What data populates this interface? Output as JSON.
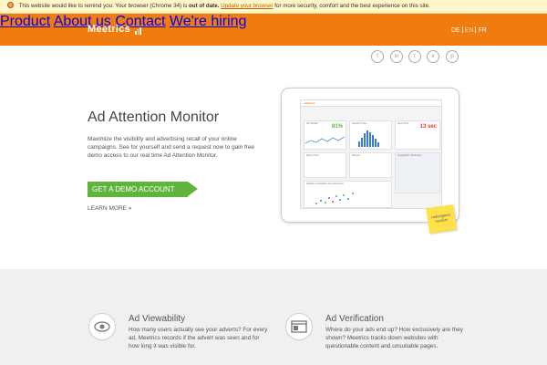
{
  "warning": {
    "pre": "This website would like to remind you: Your browser (Chrome 34) is",
    "bold": "out of date.",
    "link": "Update your browser",
    "post": "for more security, comfort and the best experience on this site."
  },
  "header": {
    "logo": "Meetrics",
    "nav": [
      "Product",
      "About us",
      "Contact",
      "We're hiring"
    ],
    "lang": [
      "DE",
      "EN",
      "FR"
    ],
    "lang_active": "EN"
  },
  "social": [
    "facebook-icon",
    "linkedin-icon",
    "twitter-icon",
    "xing-icon",
    "pinterest-icon"
  ],
  "hero": {
    "title": "Ad Attention Monitor",
    "text": "Maximize the visibility and advertising recall of your online campaigns. See for yourself and send a request now to gain free demo access to our real time Ad Attention Monitor.",
    "cta": "GET A DEMO ACCOUNT",
    "learn_more": "LEARN MORE »"
  },
  "dashboard": {
    "brand": "meetrics",
    "panels": [
      {
        "title": "Ad Visibility",
        "value": "81%",
        "color": "#5fb43c"
      },
      {
        "title": "Gender & Age",
        "value": "",
        "color": ""
      },
      {
        "title": "View Time",
        "value": "13 sec",
        "color": "#e53935"
      },
      {
        "title": "Reach (UC)",
        "value": "",
        "color": ""
      },
      {
        "title": "Devices",
        "value": "",
        "color": ""
      },
      {
        "title": "Geographic distribution",
        "value": "",
        "color": ""
      },
      {
        "title": "Visibility & dwelltime per placement",
        "value": "",
        "color": ""
      }
    ]
  },
  "sticker": "redesigned version",
  "features": [
    {
      "icon": "eye-icon",
      "title": "Ad Viewability",
      "text": "How many users actually see your adverts? For every ad, Meetrics records if the advert was seen and for how long it was visible for."
    },
    {
      "icon": "browser-window-icon",
      "title": "Ad Verification",
      "text": "Where do your ads end up? How exclusively are they shown? Meetrics tracks down websites with questionable content and unsuitable pages."
    }
  ],
  "colors": {
    "brand_orange": "#f07c10",
    "cta_green": "#5fb43c",
    "warning_bg": "#fdf6c8"
  }
}
